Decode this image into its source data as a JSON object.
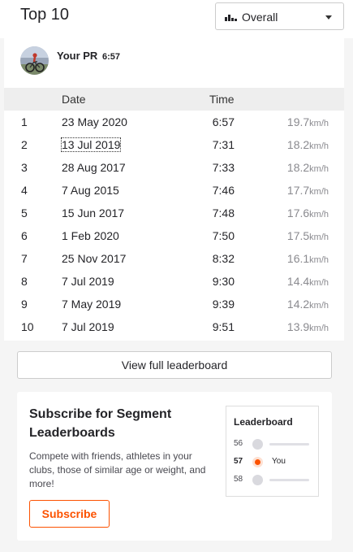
{
  "header": {
    "title": "Top 10",
    "filter": {
      "selected": "Overall",
      "icon": "bar-chart-icon"
    }
  },
  "pr": {
    "label": "Your PR",
    "value": "6:57"
  },
  "table": {
    "columns": {
      "date": "Date",
      "time": "Time"
    },
    "rows": [
      {
        "rank": "1",
        "date": "23 May 2020",
        "time": "6:57",
        "speed": "19.7",
        "unit": "km/h"
      },
      {
        "rank": "2",
        "date": "13 Jul 2019",
        "time": "7:31",
        "speed": "18.2",
        "unit": "km/h"
      },
      {
        "rank": "3",
        "date": "28 Aug 2017",
        "time": "7:33",
        "speed": "18.2",
        "unit": "km/h"
      },
      {
        "rank": "4",
        "date": "7 Aug 2015",
        "time": "7:46",
        "speed": "17.7",
        "unit": "km/h"
      },
      {
        "rank": "5",
        "date": "15 Jun 2017",
        "time": "7:48",
        "speed": "17.6",
        "unit": "km/h"
      },
      {
        "rank": "6",
        "date": "1 Feb 2020",
        "time": "7:50",
        "speed": "17.5",
        "unit": "km/h"
      },
      {
        "rank": "7",
        "date": "25 Nov 2017",
        "time": "8:32",
        "speed": "16.1",
        "unit": "km/h"
      },
      {
        "rank": "8",
        "date": "7 Jul 2019",
        "time": "9:30",
        "speed": "14.4",
        "unit": "km/h"
      },
      {
        "rank": "9",
        "date": "7 May 2019",
        "time": "9:39",
        "speed": "14.2",
        "unit": "km/h"
      },
      {
        "rank": "10",
        "date": "7 Jul 2019",
        "time": "9:51",
        "speed": "13.9",
        "unit": "km/h"
      }
    ]
  },
  "leaderboard_button": "View full leaderboard",
  "promo": {
    "title": "Subscribe for Segment Leaderboards",
    "description": "Compete with friends, athletes in your clubs, those of similar age or weight, and more!",
    "button": "Subscribe",
    "preview": {
      "title": "Leaderboard",
      "rows": [
        {
          "rank": "56",
          "you": ""
        },
        {
          "rank": "57",
          "you": "You"
        },
        {
          "rank": "58",
          "you": ""
        }
      ]
    }
  },
  "colors": {
    "accent": "#fc5200",
    "muted": "#8a8a8f",
    "header_bg": "#eeeeee"
  }
}
